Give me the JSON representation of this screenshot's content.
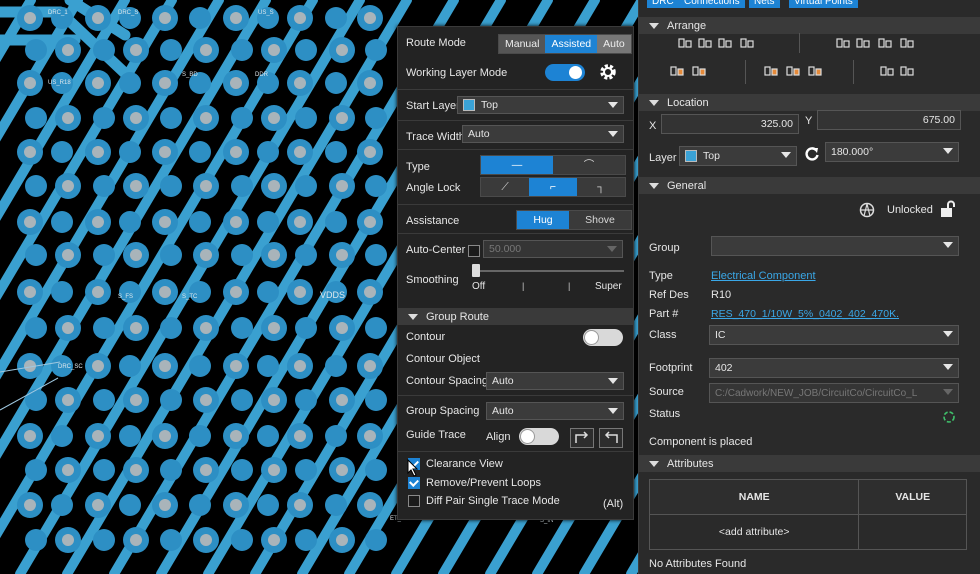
{
  "pcb": {
    "labels": [
      "US_R18",
      "DRC_1",
      "US_S",
      "DRC_S",
      "VDDS",
      "S_BD",
      "DDR",
      "S_TC",
      "S_FS",
      "DRC_SC",
      "ET_S",
      "S_IN"
    ]
  },
  "route_panel": {
    "route_mode_label": "Route Mode",
    "route_mode_options": [
      "Manual",
      "Assisted",
      "Auto"
    ],
    "working_layer_mode_label": "Working Layer Mode",
    "working_layer_mode_on": true,
    "start_layer_label": "Start Layer",
    "start_layer_value": "Top",
    "trace_width_label": "Trace Width",
    "trace_width_value": "Auto",
    "type_label": "Type",
    "angle_lock_label": "Angle Lock",
    "assistance_label": "Assistance",
    "assistance_options": [
      "Hug",
      "Shove"
    ],
    "auto_center_label": "Auto-Center",
    "auto_center_value": "50.000",
    "smoothing_label": "Smoothing",
    "smoothing_min": "Off",
    "smoothing_max": "Super",
    "group_route_header": "Group Route",
    "contour_label": "Contour",
    "contour_object_label": "Contour Object",
    "contour_spacing_label": "Contour Spacing",
    "contour_spacing_value": "Auto",
    "group_spacing_label": "Group Spacing",
    "group_spacing_value": "Auto",
    "guide_trace_label": "Guide Trace",
    "align_label": "Align",
    "clearance_view_label": "Clearance View",
    "remove_loops_label": "Remove/Prevent Loops",
    "diff_pair_label": "Diff Pair Single Trace Mode",
    "alt_hint": "(Alt)"
  },
  "properties": {
    "tabs": [
      "DRC",
      "Connections",
      "Nets",
      "Virtual Points"
    ],
    "arrange_header": "Arrange",
    "location_header": "Location",
    "x_label": "X",
    "x_value": "325.00",
    "y_label": "Y",
    "y_value": "675.00",
    "layer_label": "Layer",
    "layer_value": "Top",
    "rotation_value": "180.000°",
    "general_header": "General",
    "lock_status": "Unlocked",
    "group_label": "Group",
    "type_label": "Type",
    "type_value": "Electrical Component",
    "ref_des_label": "Ref Des",
    "ref_des_value": "R10",
    "part_label": "Part #",
    "part_value": "RES_470_1/10W_5%_0402_402_470K.",
    "class_label": "Class",
    "class_value": "IC",
    "footprint_label": "Footprint",
    "footprint_value": "402",
    "source_label": "Source",
    "source_value": "C:/Cadwork/NEW_JOB/CircuitCo/CircuitCo_L",
    "status_label": "Status",
    "placed_text": "Component is placed",
    "attributes_header": "Attributes",
    "col_name": "NAME",
    "col_value": "VALUE",
    "add_attribute": "<add attribute>",
    "no_attributes": "No Attributes Found"
  }
}
